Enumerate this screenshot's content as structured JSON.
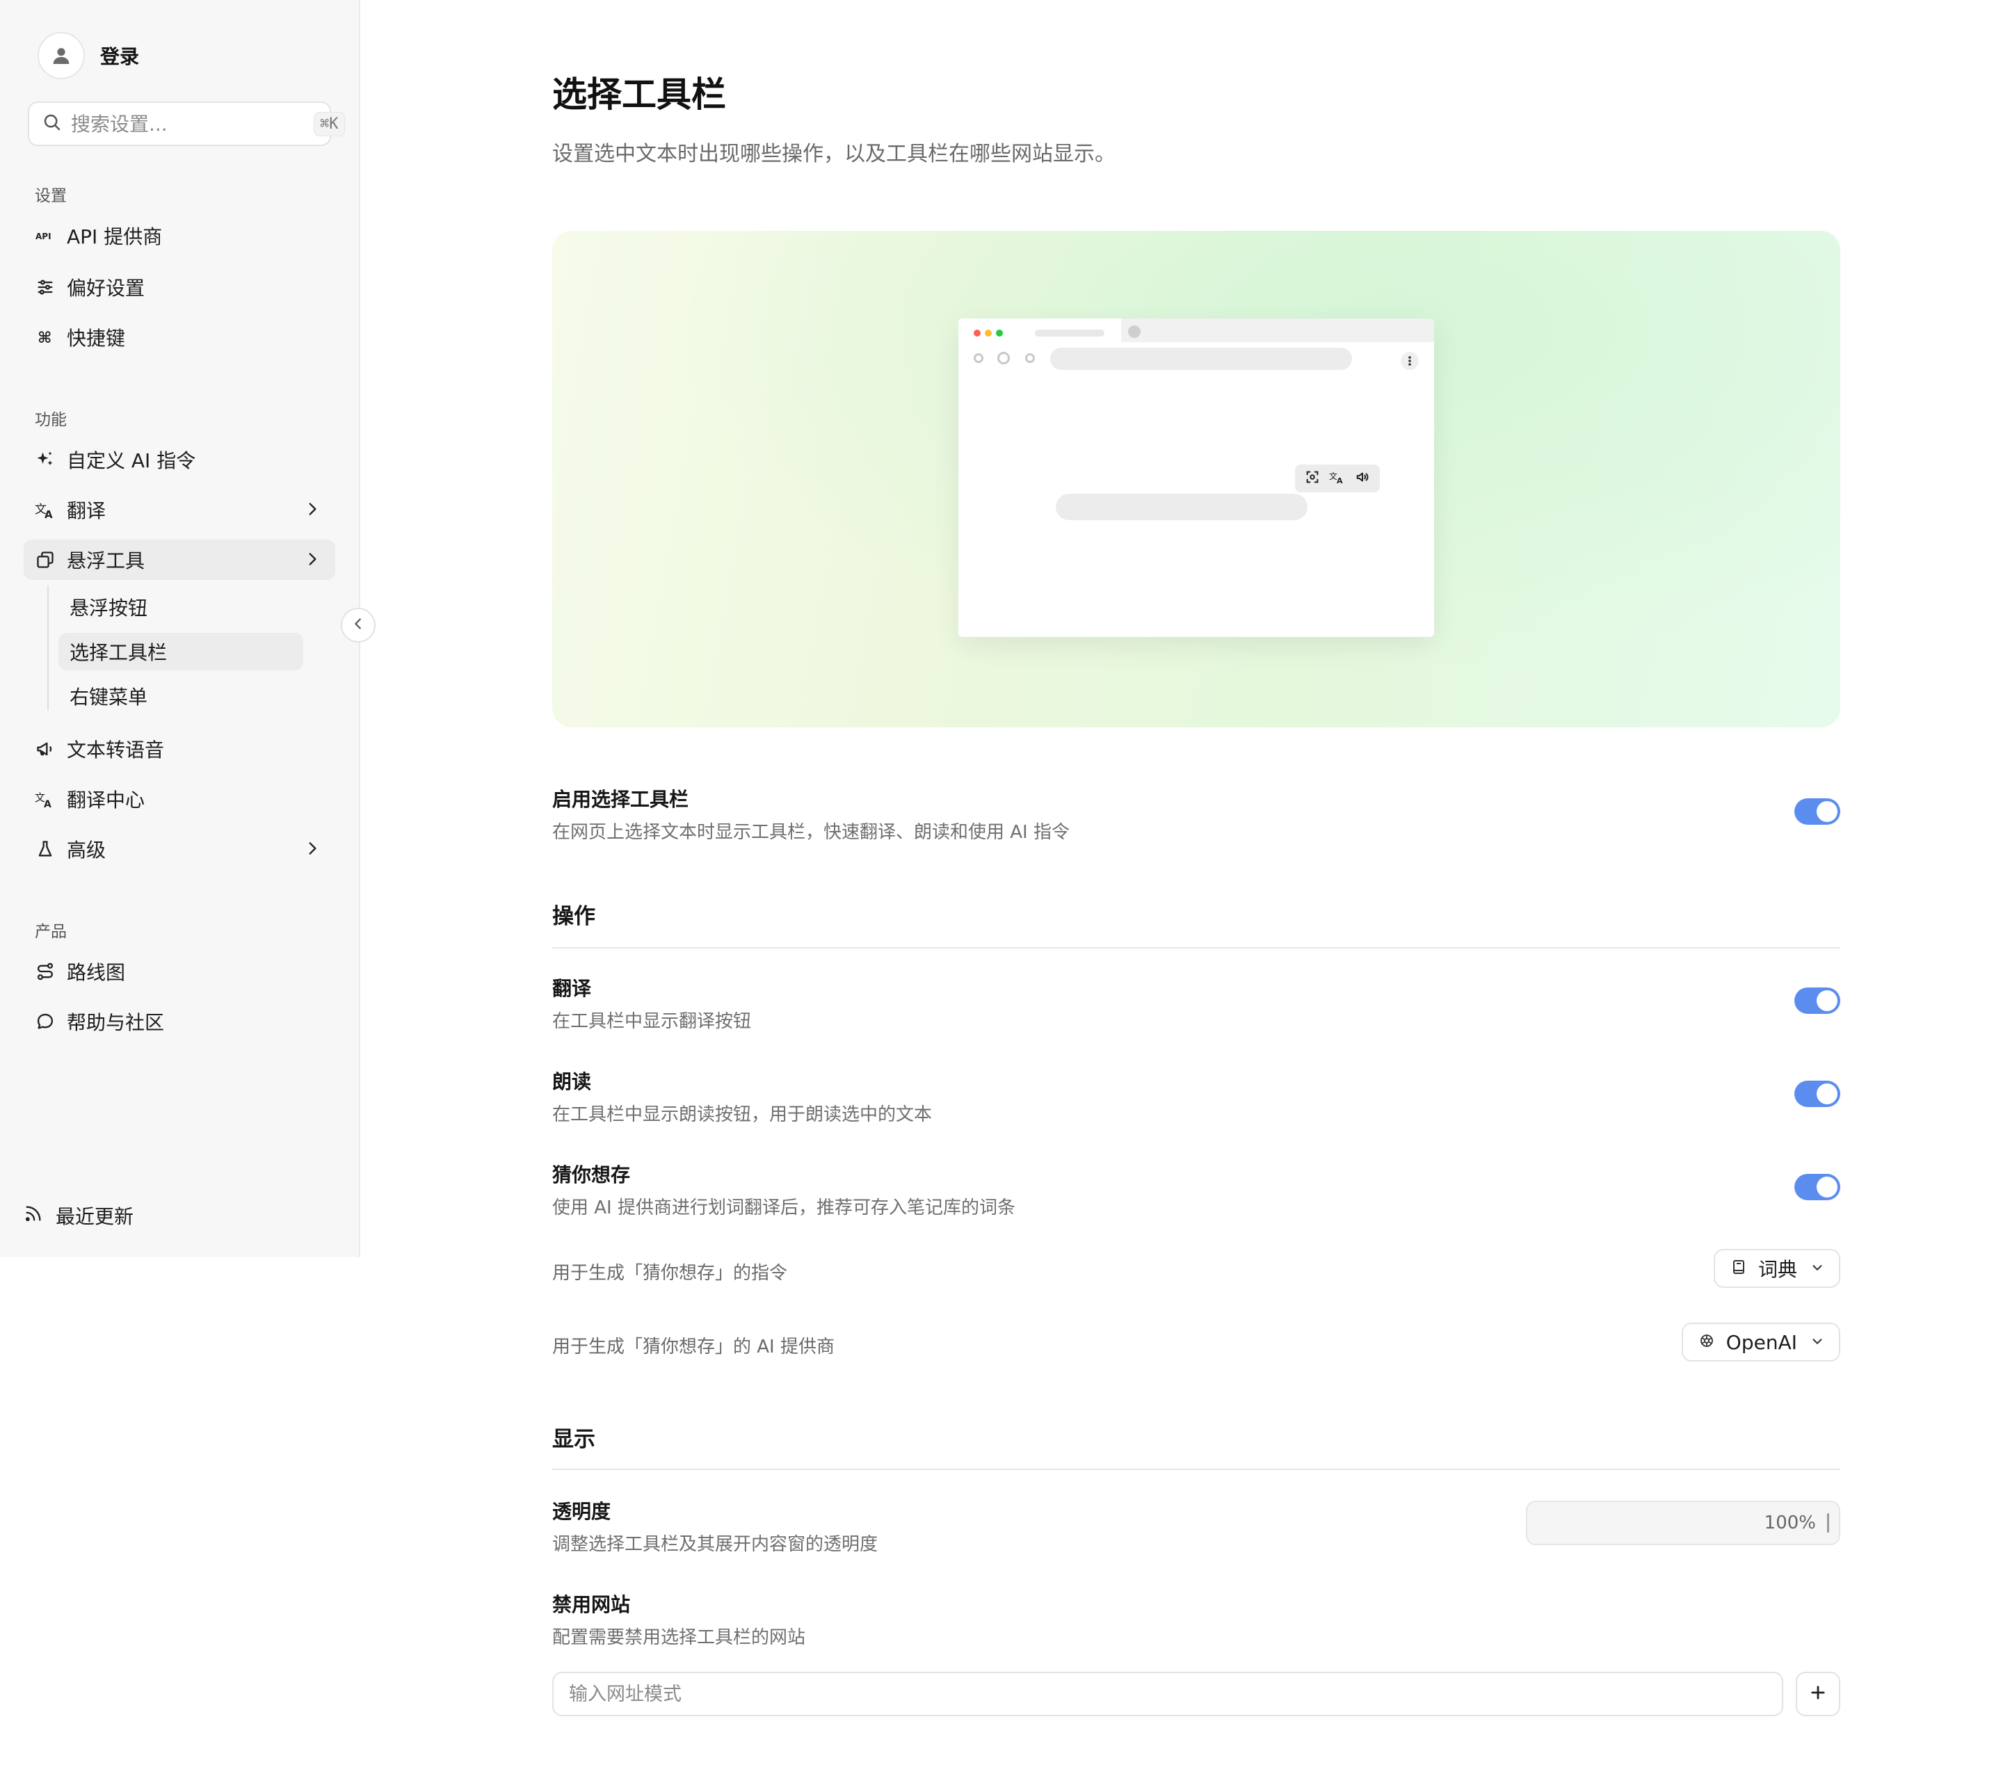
{
  "sidebar": {
    "login_label": "登录",
    "search": {
      "placeholder": "搜索设置...",
      "shortcut": "⌘K"
    },
    "sections": {
      "settings": "设置",
      "features": "功能",
      "product": "产品"
    },
    "items": {
      "api": "API 提供商",
      "preferences": "偏好设置",
      "shortcuts": "快捷键",
      "custom_ai": "自定义 AI 指令",
      "translate": "翻译",
      "floating_tools": "悬浮工具",
      "floating_button": "悬浮按钮",
      "selection_toolbar": "选择工具栏",
      "context_menu": "右键菜单",
      "tts": "文本转语音",
      "translation_hub": "翻译中心",
      "advanced": "高级",
      "roadmap": "路线图",
      "help": "帮助与社区"
    },
    "recent_updates": "最近更新"
  },
  "page": {
    "title": "选择工具栏",
    "description": "设置选中文本时出现哪些操作，以及工具栏在哪些网站显示。"
  },
  "enable": {
    "title": "启用选择工具栏",
    "description": "在网页上选择文本时显示工具栏，快速翻译、朗读和使用 AI 指令",
    "on": true
  },
  "actions": {
    "group_title": "操作",
    "translate": {
      "title": "翻译",
      "description": "在工具栏中显示翻译按钮",
      "on": true
    },
    "read_aloud": {
      "title": "朗读",
      "description": "在工具栏中显示朗读按钮，用于朗读选中的文本",
      "on": true
    },
    "guess_save": {
      "title": "猜你想存",
      "description": "使用 AI 提供商进行划词翻译后，推荐可存入笔记库的词条",
      "on": true
    },
    "prompt_label": "用于生成「猜你想存」的指令",
    "prompt_value": "词典",
    "provider_label": "用于生成「猜你想存」的 AI 提供商",
    "provider_value": "OpenAI"
  },
  "display": {
    "group_title": "显示",
    "opacity": {
      "title": "透明度",
      "description": "调整选择工具栏及其展开内容窗的透明度",
      "value": "100%"
    },
    "blocked_sites": {
      "title": "禁用网站",
      "description": "配置需要禁用选择工具栏的网站",
      "placeholder": "输入网址模式"
    }
  },
  "colors": {
    "accent": "#5b8def",
    "sidebar_bg": "#f7f7f7"
  }
}
